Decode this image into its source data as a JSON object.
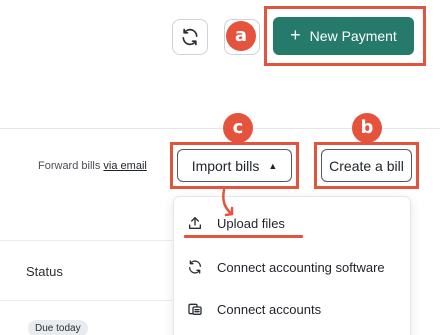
{
  "toolbar": {
    "refresh_icon": "refresh-icon",
    "new_payment_label": "New Payment",
    "new_payment_plus": "+",
    "accent_color": "#257a6b"
  },
  "annotations": {
    "a": "a",
    "b": "b",
    "c": "c",
    "highlight_color": "#e5533d"
  },
  "bills": {
    "forward_prefix": "Forward bills",
    "forward_link": "via email",
    "import_label": "Import bills",
    "import_caret": "▲",
    "create_label": "Create a bill"
  },
  "import_menu": {
    "items": [
      {
        "label": "Upload files",
        "icon": "upload-icon"
      },
      {
        "label": "Connect accounting software",
        "icon": "sync-icon"
      },
      {
        "label": "Connect accounts",
        "icon": "bank-accounts-icon"
      }
    ]
  },
  "table": {
    "status_header": "Status",
    "first_badge": "Due today"
  }
}
